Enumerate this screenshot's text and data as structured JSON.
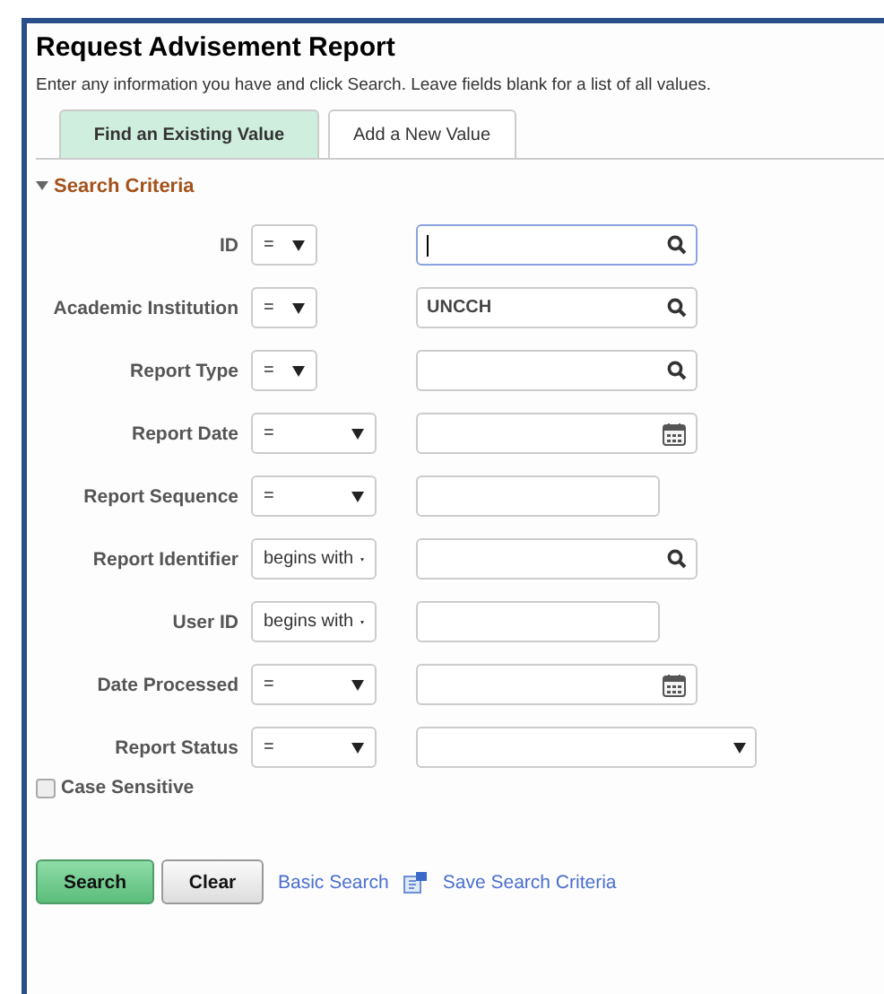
{
  "page": {
    "title": "Request Advisement Report",
    "instructions": "Enter any information you have and click Search. Leave fields blank for a list of all values."
  },
  "tabs": [
    {
      "label": "Find an Existing Value",
      "selected": true
    },
    {
      "label": "Add a New Value",
      "selected": false
    }
  ],
  "section": {
    "title": "Search Criteria",
    "expanded": true
  },
  "fields": [
    {
      "label": "ID",
      "operator": {
        "label": "=",
        "kind": "short"
      },
      "kind": "lookup",
      "focused": true
    },
    {
      "label": "Academic Institution",
      "operator": {
        "label": "=",
        "kind": "short"
      },
      "kind": "lookup",
      "value": "UNCCH",
      "focused": false
    },
    {
      "label": "Report Type",
      "operator": {
        "label": "=",
        "kind": "short"
      },
      "kind": "lookup",
      "focused": false
    },
    {
      "label": "Report Date",
      "operator": {
        "label": "=",
        "kind": "long"
      },
      "kind": "date",
      "focused": false
    },
    {
      "label": "Report Sequence",
      "operator": {
        "label": "=",
        "kind": "long"
      },
      "kind": "text",
      "focused": false
    },
    {
      "label": "Report Identifier",
      "operator": {
        "label": "begins with",
        "kind": "long"
      },
      "kind": "lookup",
      "focused": false
    },
    {
      "label": "User ID",
      "operator": {
        "label": "begins with",
        "kind": "long"
      },
      "kind": "text",
      "focused": false
    },
    {
      "label": "Date Processed",
      "operator": {
        "label": "=",
        "kind": "long"
      },
      "kind": "date",
      "focused": false
    },
    {
      "label": "Report Status",
      "operator": {
        "label": "=",
        "kind": "long"
      },
      "kind": "select",
      "focused": false
    }
  ],
  "case_sensitive": {
    "label": "Case Sensitive",
    "checked": false
  },
  "buttons": [
    {
      "label": "Search",
      "kind": "primary"
    },
    {
      "label": "Clear",
      "kind": "secondary"
    }
  ],
  "links": [
    {
      "label": "Basic Search",
      "icon": false
    },
    {
      "label": "Save Search Criteria",
      "icon": true
    }
  ]
}
